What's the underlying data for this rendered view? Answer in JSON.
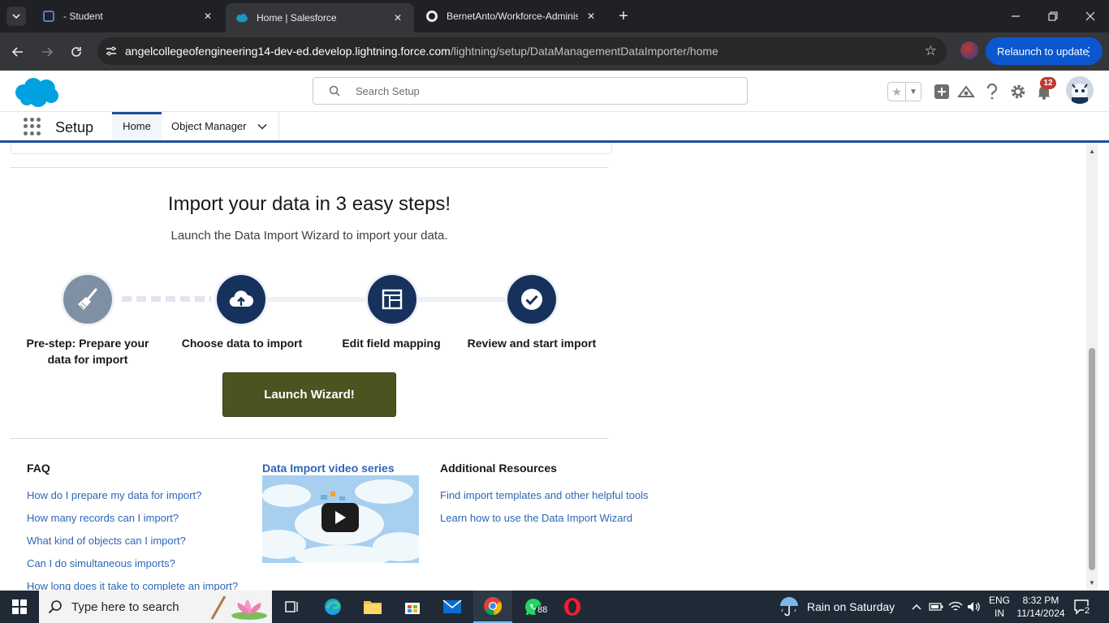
{
  "browser": {
    "tabs": [
      {
        "title": "- Student"
      },
      {
        "title": "Home | Salesforce"
      },
      {
        "title": "BernetAnto/Workforce-Administration"
      }
    ],
    "url_host": "angelcollegeofengineering14-dev-ed.develop.lightning.force.com",
    "url_path": "/lightning/setup/DataManagementDataImporter/home",
    "relaunch_label": "Relaunch to update"
  },
  "sf_header": {
    "search_placeholder": "Search Setup",
    "notification_count": "12"
  },
  "app_nav": {
    "app_name": "Setup",
    "tabs": [
      {
        "label": "Home"
      },
      {
        "label": "Object Manager"
      }
    ]
  },
  "importer": {
    "title": "Import your data in 3 easy steps!",
    "subtitle": "Launch the Data Import Wizard to import your data.",
    "steps": [
      {
        "label_line1": "Pre-step: Prepare your",
        "label_line2": "data for import",
        "icon": "broom-icon"
      },
      {
        "label_line1": "Choose data to import",
        "icon": "cloud-upload-icon"
      },
      {
        "label_line1": "Edit field mapping",
        "icon": "table-layout-icon"
      },
      {
        "label_line1": "Review and start import",
        "icon": "check-circle-icon"
      }
    ],
    "launch_label": "Launch Wizard!"
  },
  "faq": {
    "heading": "FAQ",
    "items": [
      "How do I prepare my data for import?",
      "How many records can I import?",
      "What kind of objects can I import?",
      "Can I do simultaneous imports?",
      "How long does it take to complete an import?"
    ]
  },
  "video": {
    "heading": "Data Import video series"
  },
  "resources": {
    "heading": "Additional Resources",
    "items": [
      "Find import templates and other helpful tools",
      "Learn how to use the Data Import Wizard"
    ]
  },
  "taskbar": {
    "search_placeholder": "Type here to search",
    "whatsapp_badge": "88",
    "weather": "Rain on Saturday",
    "lang_line1": "ENG",
    "lang_line2": "IN",
    "time": "8:32 PM",
    "date": "11/14/2024",
    "notification_count": "2"
  },
  "colors": {
    "sf_blue": "#1b5297",
    "step_navy": "#16325c",
    "launch_olive": "#4b5320",
    "link_blue": "#2e66b8"
  }
}
